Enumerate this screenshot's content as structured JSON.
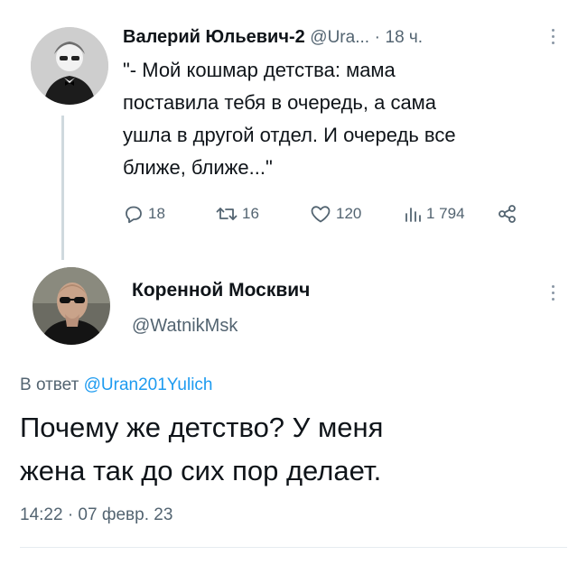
{
  "tweet1": {
    "author_name": "Валерий Юльевич-2",
    "handle": "@Ura...",
    "separator": "·",
    "time": "18 ч.",
    "text_lines": [
      "\"- Мой кошмар детства: мама",
      "поставила тебя в очередь, а сама",
      "ушла в другой отдел. И очередь все",
      "ближе, ближе...\""
    ],
    "replies": "18",
    "retweets": "16",
    "likes": "120",
    "views": "1 794"
  },
  "tweet2": {
    "author_name": "Коренной Москвич",
    "handle": "@WatnikMsk",
    "reply_prefix": "В ответ",
    "reply_mention": "@Uran201Yulich",
    "text_lines": [
      "Почему же детство? У меня",
      "жена так до сих пор делает."
    ],
    "timestamp": "14:22 · 07 февр. 23"
  },
  "colors": {
    "text": "#0f1419",
    "muted": "#536471",
    "accent": "#1d9bf0",
    "thread_line": "#cfd9de"
  },
  "icons": [
    "avatar-photo",
    "more-options-icon",
    "reply-icon",
    "retweet-icon",
    "like-icon",
    "views-icon",
    "share-icon"
  ]
}
